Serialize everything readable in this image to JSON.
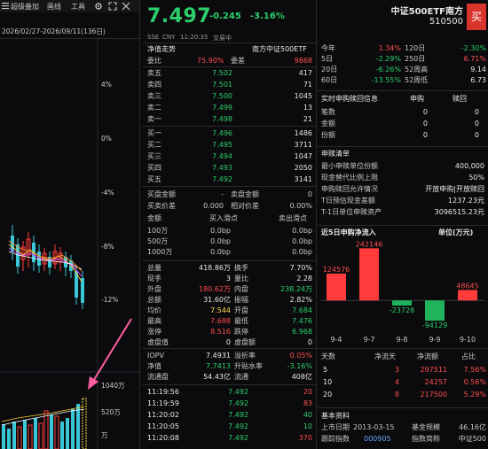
{
  "left_panel": {
    "toolbar": {
      "tab1": "超级叠加",
      "tab2": "画线",
      "tab3": "工具"
    },
    "date_range": "2026/02/27-2026/09/11(136日)",
    "pct_labels": [
      "4%",
      "0%",
      "-4%",
      "-8%",
      "-12%"
    ],
    "vol_labels": [
      "1040万",
      "520万",
      "万"
    ]
  },
  "header": {
    "price": "7.497",
    "change": "-0.245",
    "change_pct": "-3.16%",
    "name": "中证500ETF南方",
    "code": "510500",
    "buy_button": "买",
    "exchange": "SSE",
    "currency": "CNY",
    "time": "11:20:35",
    "status": "交易中"
  },
  "order_book": {
    "col1": "净值走势",
    "col2": "南方中证500ETF",
    "weibi": {
      "label": "委比",
      "value": "75.90%",
      "label2": "委差",
      "value2": "9868"
    },
    "asks": [
      {
        "label": "卖五",
        "price": "7.502",
        "vol": "417"
      },
      {
        "label": "卖四",
        "price": "7.501",
        "vol": "71"
      },
      {
        "label": "卖三",
        "price": "7.500",
        "vol": "1045"
      },
      {
        "label": "卖二",
        "price": "7.499",
        "vol": "13"
      },
      {
        "label": "卖一",
        "price": "7.498",
        "vol": "21"
      }
    ],
    "bids": [
      {
        "label": "买一",
        "price": "7.496",
        "vol": "1486"
      },
      {
        "label": "买二",
        "price": "7.495",
        "vol": "3711"
      },
      {
        "label": "买三",
        "price": "7.494",
        "vol": "1047"
      },
      {
        "label": "买四",
        "price": "7.493",
        "vol": "2050"
      },
      {
        "label": "买五",
        "price": "7.492",
        "vol": "3141"
      }
    ]
  },
  "subscription": {
    "r1": {
      "a": "买盘金额",
      "b": "-",
      "c": "卖盘金额",
      "d": "0"
    },
    "r2": {
      "a": "买卖价差",
      "b": "0.000",
      "c": "相对价差",
      "d": "0.00%"
    },
    "header": {
      "a": "金额",
      "b": "买入滑点",
      "c": "卖出滑点"
    },
    "rows": [
      {
        "amt": "100万",
        "buy": "0.0bp",
        "sell": "0.0bp"
      },
      {
        "amt": "500万",
        "buy": "0.0bp",
        "sell": "0.0bp"
      },
      {
        "amt": "1000万",
        "buy": "0.0bp",
        "sell": "0.0bp"
      }
    ]
  },
  "stats": [
    {
      "l1": "总量",
      "v1": "418.86万",
      "l2": "换手",
      "v2": "7.70%"
    },
    {
      "l1": "现手",
      "v1": "3",
      "l2": "量比",
      "v2": "2.28"
    },
    {
      "l1": "外盘",
      "v1": "180.62万",
      "l2": "内盘",
      "v2": "238.24万"
    },
    {
      "l1": "总额",
      "v1": "31.60亿",
      "l2": "振幅",
      "v2": "2.82%"
    },
    {
      "l1": "均价",
      "v1": "7.544",
      "l2": "开盘",
      "v2": "7.684"
    },
    {
      "l1": "最高",
      "v1": "7.688",
      "l2": "最低",
      "v2": "7.476"
    },
    {
      "l1": "涨停",
      "v1": "8.516",
      "l2": "跌停",
      "v2": "6.968"
    },
    {
      "l1": "虚盘值",
      "v1": "0",
      "l2": "虚盘额",
      "v2": "0"
    }
  ],
  "iopv": [
    {
      "l1": "IOPV",
      "v1": "7.4931",
      "l2": "溢折率",
      "v2": "0.05%"
    },
    {
      "l1": "净值",
      "v1": "7.7413",
      "l2": "升贴水率",
      "v2": "-3.16%"
    },
    {
      "l1": "流通盘",
      "v1": "54.43亿",
      "l2": "流通",
      "v2": "408亿"
    }
  ],
  "ticks": [
    {
      "time": "11:19:56",
      "price": "7.492",
      "vol": "20"
    },
    {
      "time": "11:19:59",
      "price": "7.492",
      "vol": "83"
    },
    {
      "time": "11:20:02",
      "price": "7.492",
      "vol": "40"
    },
    {
      "time": "11:20:05",
      "price": "7.492",
      "vol": "10"
    },
    {
      "time": "11:20:08",
      "price": "7.492",
      "vol": "370"
    }
  ],
  "right_panel": {
    "period": [
      {
        "l1": "今年",
        "v1": "1.34%",
        "l2": "120日",
        "v2": "-2.30%"
      },
      {
        "l1": "5日",
        "v1": "-2.29%",
        "l2": "250日",
        "v2": "6.71%"
      },
      {
        "l1": "20日",
        "v1": "-6.26%",
        "l2": "52周高",
        "v2": "9.14"
      },
      {
        "l1": "60日",
        "v1": "-13.55%",
        "l2": "52周低",
        "v2": "6.73"
      }
    ],
    "realtime": {
      "title": "实时申购赎回信息",
      "col1": "申购",
      "col2": "赎回",
      "rows": [
        {
          "label": "笔数",
          "a": "0",
          "b": "0"
        },
        {
          "label": "金额",
          "a": "0",
          "b": "0"
        },
        {
          "label": "份额",
          "a": "0",
          "b": "0"
        }
      ]
    },
    "subscription_list": {
      "title": "申赎清单",
      "rows": [
        {
          "label": "最小申赎单位份额",
          "value": "400,000"
        },
        {
          "label": "现金替代比例上限",
          "value": "50%"
        },
        {
          "label": "申购赎回允许情况",
          "value": "开放申购|开放赎回"
        },
        {
          "label": "T日预估现金差额",
          "value": "1237.23元"
        },
        {
          "label": "T-1日单位申赎资产",
          "value": "3096515.23元"
        }
      ]
    },
    "flow_chart": {
      "title": "近5日申购净流入",
      "unit": "单位(万元)"
    },
    "flow_table": {
      "header": {
        "a": "天数",
        "b": "净流天",
        "c": "净流额",
        "d": "占比"
      },
      "rows": [
        {
          "a": "5",
          "b": "3",
          "c": "297511",
          "d": "7.56%"
        },
        {
          "a": "10",
          "b": "4",
          "c": "24257",
          "d": "0.56%"
        },
        {
          "a": "20",
          "b": "8",
          "c": "217500",
          "d": "5.29%"
        }
      ]
    },
    "basic_info": {
      "title": "基本资料",
      "r1": {
        "l1": "上市日期",
        "v1": "2013-03-15",
        "l2": "基金规模",
        "v2": "46.16亿"
      },
      "r2": {
        "l1": "跟踪指数",
        "v1": "000905",
        "l2": "指数简称",
        "v2": "中证500"
      }
    }
  },
  "chart_data": {
    "type": "bar",
    "title": "近5日申购净流入",
    "categories": [
      "9-4",
      "9-7",
      "9-8",
      "9-9",
      "9-10"
    ],
    "values": [
      124576,
      242146,
      -23728,
      -94129,
      48645
    ],
    "colors": [
      "#ff3b3b",
      "#ff3b3b",
      "#1fb35a",
      "#1fb35a",
      "#ff3b3b"
    ]
  }
}
